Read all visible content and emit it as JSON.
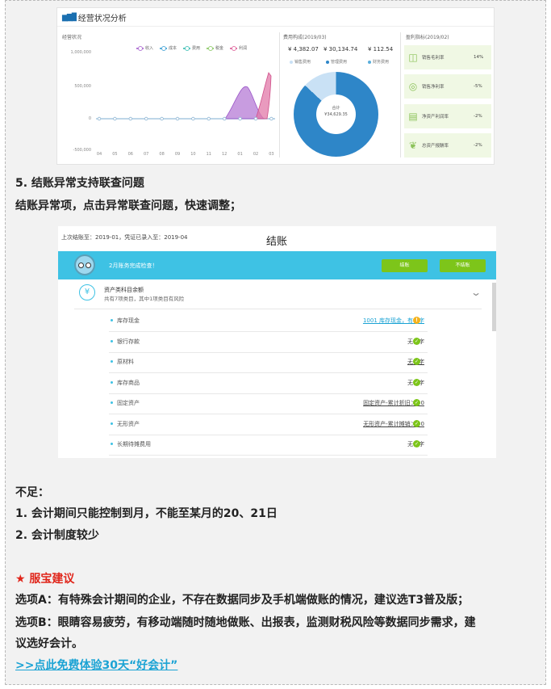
{
  "dashboard": {
    "title": "经营状况分析",
    "section_business": "经营状况",
    "section_cost": "费用构成(2019/03)",
    "section_profit": "盈利指标(2019/02)",
    "legend": [
      {
        "name": "收入",
        "color": "#b57bd6"
      },
      {
        "name": "成本",
        "color": "#5aaedb"
      },
      {
        "name": "费用",
        "color": "#59c8c0"
      },
      {
        "name": "税金",
        "color": "#9bd07a"
      },
      {
        "name": "利润",
        "color": "#e278a8"
      }
    ],
    "y_ticks": [
      "1,000,000",
      "500,000",
      "0",
      "-500,000"
    ],
    "x_ticks": [
      "04",
      "05",
      "06",
      "07",
      "08",
      "09",
      "10",
      "11",
      "12",
      "01",
      "02",
      "03"
    ],
    "cost_values": [
      "¥ 4,382.07",
      "¥ 30,134.74",
      "¥ 112.54"
    ],
    "cost_legend": [
      {
        "name": "销售费用",
        "color": "#c9e1f5"
      },
      {
        "name": "管理费用",
        "color": "#2e86c8"
      },
      {
        "name": "财务费用",
        "color": "#5aaedb"
      }
    ],
    "donut_label": "合计",
    "donut_total": "¥34,629.35",
    "profit": [
      {
        "label": "销售毛利率",
        "value": "14%",
        "icon": "chart-icon"
      },
      {
        "label": "销售净利率",
        "value": "-5%",
        "icon": "coin-icon"
      },
      {
        "label": "净资产利润率",
        "value": "-2%",
        "icon": "doc-icon"
      },
      {
        "label": "总资产报酬率",
        "value": "-2%",
        "icon": "leaf-icon"
      }
    ]
  },
  "texts": {
    "heading5": "5. 结账异常支持联查问题",
    "desc5": "结账异常项，点击异常联查问题，快速调整；",
    "shortcoming_title": "不足：",
    "shortcoming_1": "1. 会计期间只能控制到月，不能至某月的20、21日",
    "shortcoming_2": "2. 会计制度较少",
    "advice_title": "★ 服宝建议",
    "option_a": "选项A：有特殊会计期间的企业，不存在数据同步及手机端做账的情况，建议选T3普及版；",
    "option_b_1": "选项B：眼睛容易疲劳，有移动端随时随地做账、出报表，监测财税风险等数据同步需求，建",
    "option_b_2": "议选好会计。",
    "cta_link": ">>点此免费体验30天“好会计”"
  },
  "settle": {
    "info": "上次结账至：2019-01，凭证已录入至：2019-04",
    "title": "结账",
    "banner_msg": "2月账务完成检查！",
    "btn_settle": "结账",
    "btn_no_settle": "不结账",
    "category_title": "资产类科目余额",
    "category_sub": "共有7项类目，其中1项类目有风险",
    "rows": [
      {
        "name": "库存现金",
        "value": "1001 库存现金，有赤字",
        "status": "warn",
        "style": "link"
      },
      {
        "name": "银行存款",
        "value": "无赤字",
        "status": "ok",
        "style": ""
      },
      {
        "name": "原材料",
        "value": "无赤字",
        "status": "ok",
        "style": "ul"
      },
      {
        "name": "库存商品",
        "value": "无赤字",
        "status": "ok",
        "style": ""
      },
      {
        "name": "固定资产",
        "value": "固定资产-累计折旧＞=0",
        "status": "ok",
        "style": "ul"
      },
      {
        "name": "无形资产",
        "value": "无形资产-累计摊销＞=0",
        "status": "ok",
        "style": "ul"
      },
      {
        "name": "长期待摊费用",
        "value": "无赤字",
        "status": "ok",
        "style": ""
      }
    ]
  }
}
